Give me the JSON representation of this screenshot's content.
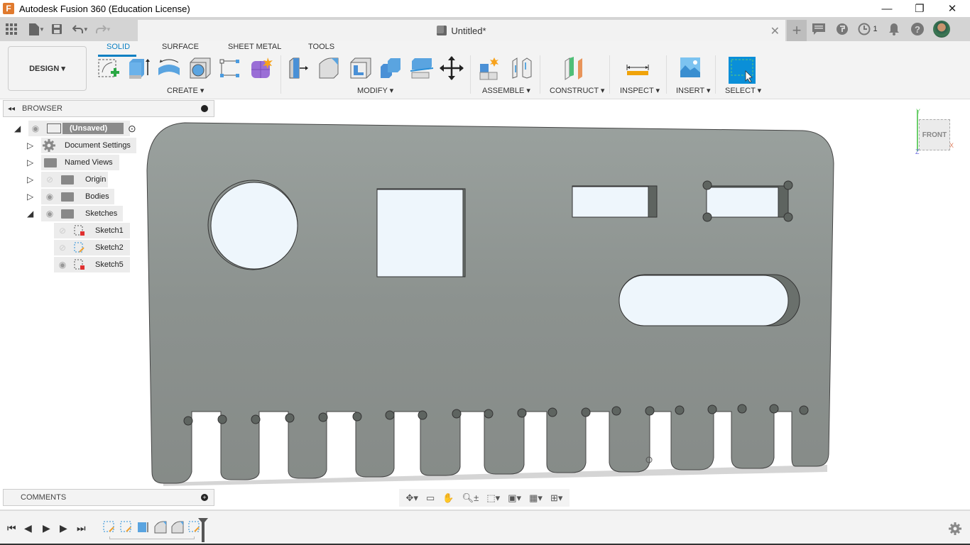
{
  "window": {
    "app_icon_letter": "F",
    "title": "Autodesk Fusion 360 (Education License)",
    "minimize_glyph": "—",
    "restore_glyph": "❐",
    "close_glyph": "✕"
  },
  "quick_access": {
    "grid_icon": "grid-icon",
    "file_icon": "file-icon",
    "save_icon": "save-icon",
    "undo_icon": "undo-icon",
    "redo_icon": "redo-icon"
  },
  "document_tab": {
    "title": "Untitled*",
    "close_glyph": "✕"
  },
  "header_right": {
    "new_tab_glyph": "+",
    "job_count": "1"
  },
  "ribbon": {
    "workspace": "DESIGN ▾",
    "tabs": [
      {
        "label": "SOLID",
        "active": true
      },
      {
        "label": "SURFACE",
        "active": false
      },
      {
        "label": "SHEET METAL",
        "active": false
      },
      {
        "label": "TOOLS",
        "active": false
      }
    ],
    "groups": [
      {
        "label": "CREATE ▾"
      },
      {
        "label": "MODIFY ▾"
      },
      {
        "label": "ASSEMBLE ▾"
      },
      {
        "label": "CONSTRUCT ▾"
      },
      {
        "label": "INSPECT ▾"
      },
      {
        "label": "INSERT ▾"
      },
      {
        "label": "SELECT ▾"
      }
    ],
    "accent": "#0a7fc2"
  },
  "browser": {
    "title": "BROWSER",
    "root": "(Unsaved)",
    "items": [
      {
        "label": "Document Settings"
      },
      {
        "label": "Named Views"
      },
      {
        "label": "Origin"
      },
      {
        "label": "Bodies"
      },
      {
        "label": "Sketches"
      }
    ],
    "sketches": [
      {
        "label": "Sketch1",
        "visible": false
      },
      {
        "label": "Sketch2",
        "visible": false
      },
      {
        "label": "Sketch5",
        "visible": true
      }
    ]
  },
  "viewcube": {
    "face": "FRONT",
    "axis_x": "X",
    "axis_y": "Y",
    "axis_z": "Z"
  },
  "comments": {
    "title": "COMMENTS"
  },
  "colors": {
    "body": "#8e9591",
    "hole": "#eef6fc"
  }
}
